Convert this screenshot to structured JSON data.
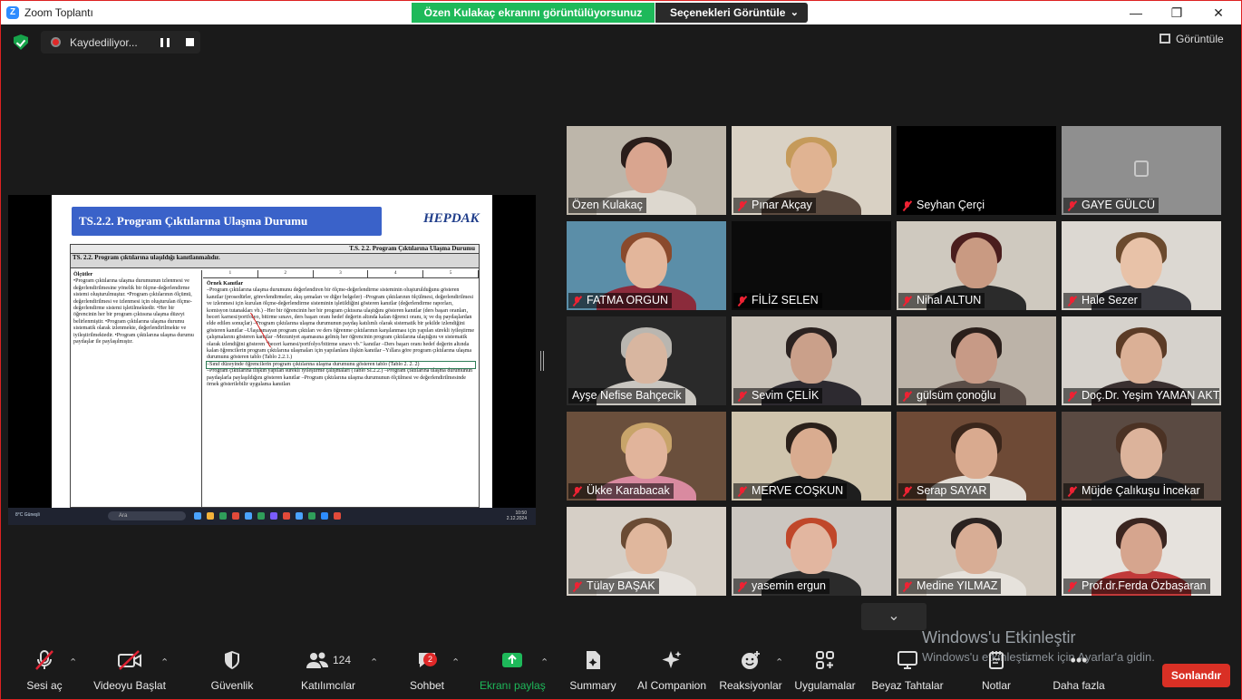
{
  "window": {
    "title": "Zoom Toplantı"
  },
  "share_banner": {
    "text": "Özen Kulakaç ekranını görüntülüyorsunuz",
    "options_label": "Seçenekleri Görüntüle"
  },
  "recording": {
    "label": "Kaydediliyor..."
  },
  "view_button": {
    "label": "Görüntüle"
  },
  "shared_doc": {
    "header": "TS.2.2. Program Çıktılarına Ulaşma Durumu",
    "logo": "HEPDAK",
    "table_title": "T.S. 2.2. Program Çıktılarına Ulaşma Durumu",
    "table_subtitle": "TS. 2.2. Program çıktılarına ulaşıldığı kanıtlanmalıdır.",
    "left_heading": "Ölçütler",
    "left_text": "•Program çıktılarına ulaşma durumunun izlenmesi ve değerlendirilmesine yönelik bir ölçme-değerlendirme sistemi oluşturulmuştur. •Program çıktılarının ölçümü, değerlendirilmesi ve izlenmesi için oluşturulan ölçme-değerlendirme sistemi işletilmektedir. •Her bir öğrencinin her bir program çıktısına ulaşma düzeyi belirlenmiştir. •Program çıktılarına ulaşma durumu sistematik olarak izlenmekte, değerlendirilmekte ve iyileştirilmektedir. •Program çıktılarına ulaşma durumu paydaşlar ile paylaşılmıştır.",
    "right_heading": "Örnek Kanıtlar",
    "right_text": "–Program çıktılarına ulaşma durumunu değerlendiren bir ölçme-değerlendirme sisteminin oluşturulduğunu gösteren kanıtlar (prosedürler, görevlendirmeler, akış şemaları ve diğer belgeler) –Program çıktılarının ölçülmesi, değerlendirilmesi ve izlenmesi için kurulan ölçme-değerlendirme sisteminin işletildiğini gösteren kanıtlar (değerlendirme raporları, komisyon tutanakları vb.) –Her bir öğrencinin her bir program çıktısına ulaştığını gösteren kanıtlar (ders başarı oranları, beceri karnesi/portfolyo, bitirme sınavı, ders başarı oranı hedef değerin altında kalan öğrenci oranı, iç ve dış paydaşlardan elde edilen sonuçlar) –Program çıktılarına ulaşma durumunun paydaş katılımlı olarak sistematik bir şekilde izlendiğini gösteren kanıtlar –Ulaşılamayan program çıktıları ve ders öğrenme çıktılarının karşılanması için yapılan sürekli iyileştirme çalışmalarını gösteren kanıtlar –Mezuniyet aşamasına gelmiş her öğrencinin program çıktılarına ulaştığını ve sistematik olarak izlendiğini gösteren \"beceri karnesi/portfolyo/bitirme sınavı vb.\" kanıtlar –Ders başarı oranı hedef değerin altında kalan öğrencilerin program çıktılarına ulaşmaları için yapılanlara ilişkin kanıtlar –Yıllara göre program çıktılarına ulaşma durumunu gösteren tablo (Tablo 2.2.1.)",
    "highlight_text": "–Sınıf düzeyinde öğrencilerin program çıktılarına ulaşma durumunu gösteren tablo (Tablo 2. 2. 2)",
    "right_text_2": "–Program çıktılarına ilişkin yapılan sürekli iyileştirme çalışmaları (Tablo Sİ.2.2.) –Program çıktılarına ulaşma durumunun paydaşlarla paylaşıldığını gösteren kanıtlar –Program çıktılarına ulaşma durumunun ölçülmesi ve değerlendirilmesinde örnek gösterilebilir uygulama kanıtları",
    "col_numbers": [
      "1",
      "2",
      "3",
      "4",
      "5"
    ],
    "taskbar": {
      "weather": "8°C Güneşli",
      "search": "Ara",
      "time": "10:50",
      "date": "2.12.2024"
    }
  },
  "participants": [
    {
      "name": "Özen Kulakaç",
      "muted": false,
      "active": true,
      "bg": "#bdb6aa",
      "skin": "#d9a58f",
      "hair": "#2a1d1a",
      "shirt": "#ddd8cf"
    },
    {
      "name": "Pınar Akçay",
      "muted": true,
      "bg": "#d9d1c4",
      "skin": "#e0b392",
      "hair": "#c59a5a",
      "shirt": "#5b4a3f"
    },
    {
      "name": "Seyhan Çerçi",
      "muted": true,
      "bg": "#000000",
      "skin": "",
      "hair": "",
      "shirt": ""
    },
    {
      "name": "GAYE GÜLCÜ",
      "muted": true,
      "bg": "#8f8f8f",
      "skin": "",
      "hair": "",
      "shirt": "",
      "placeholder": true
    },
    {
      "name": "FATMA ORGUN",
      "muted": true,
      "bg": "#5b8ea8",
      "skin": "#e3b69b",
      "hair": "#8a4a2c",
      "shirt": "#8b2b3b"
    },
    {
      "name": "FİLİZ SELEN",
      "muted": true,
      "bg": "#0b0b0b",
      "skin": "",
      "hair": "",
      "shirt": ""
    },
    {
      "name": "Nihal ALTUN",
      "muted": true,
      "bg": "#cfc9bf",
      "skin": "#c99a82",
      "hair": "#4a1d1d",
      "shirt": "#2b2b2b"
    },
    {
      "name": "Hale Sezer",
      "muted": true,
      "bg": "#dcd8d2",
      "skin": "#e8c2a8",
      "hair": "#6b4a2e",
      "shirt": "#3a3a40"
    },
    {
      "name": "Ayşe Nefise Bahçecik",
      "muted": false,
      "bg": "#2a2a2a",
      "skin": "#d8b6a0",
      "hair": "#b9b6b0",
      "shirt": "#c9c6c0"
    },
    {
      "name": "Sevim ÇELİK",
      "muted": true,
      "bg": "#c9c2b8",
      "skin": "#caa08a",
      "hair": "#2b2220",
      "shirt": "#2d2a30"
    },
    {
      "name": "gülsüm çonoğlu",
      "muted": true,
      "bg": "#bcb3a8",
      "skin": "#c79a86",
      "hair": "#2a1f1b",
      "shirt": "#5a4d47"
    },
    {
      "name": "Doç.Dr. Yeşim YAMAN AKTAŞ",
      "muted": true,
      "bg": "#d6d2cc",
      "skin": "#dbb096",
      "hair": "#5b3b26",
      "shirt": "#3a3030"
    },
    {
      "name": "Ükke Karabacak",
      "muted": true,
      "bg": "#6a4f3c",
      "skin": "#e1b49b",
      "hair": "#c8a46a",
      "shirt": "#d98aa0"
    },
    {
      "name": "MERVE COŞKUN",
      "muted": true,
      "bg": "#cfc4ad",
      "skin": "#d9ac90",
      "hair": "#2a201a",
      "shirt": "#1e1e1e"
    },
    {
      "name": "Serap SAYAR",
      "muted": true,
      "bg": "#6e4a36",
      "skin": "#d9aa8f",
      "hair": "#3a261b",
      "shirt": "#e2ddd6"
    },
    {
      "name": "Müjde Çalıkuşu İncekar",
      "muted": true,
      "bg": "#5a4a42",
      "skin": "#dcb39b",
      "hair": "#4b3224",
      "shirt": "#2b2b2e"
    },
    {
      "name": "Tülay BAŞAK",
      "muted": true,
      "bg": "#d6cfc6",
      "skin": "#e0b79d",
      "hair": "#6a4b34",
      "shirt": "#e6e2dd"
    },
    {
      "name": "yasemin ergun",
      "muted": true,
      "bg": "#cbc6c0",
      "skin": "#e2b6a0",
      "hair": "#c0472a",
      "shirt": "#2b2b2b"
    },
    {
      "name": "Medine YILMAZ",
      "muted": true,
      "bg": "#d0c8bd",
      "skin": "#d8ad95",
      "hair": "#2a2220",
      "shirt": "#e6e2dc"
    },
    {
      "name": "Prof.dr.Ferda Özbaşaran",
      "muted": true,
      "bg": "#e6e2dd",
      "skin": "#d6a58e",
      "hair": "#3a2520",
      "shirt": "#c13a3a"
    }
  ],
  "watermark": {
    "line1": "Windows'u Etkinleştir",
    "line2": "Windows'u etkinleştirmek için Ayarlar'a gidin."
  },
  "toolbar": {
    "audio": "Sesi aç",
    "video": "Videoyu Başlat",
    "security": "Güvenlik",
    "participants": "Katılımcılar",
    "participants_count": "124",
    "chat": "Sohbet",
    "chat_badge": "2",
    "share": "Ekranı paylaş",
    "summary": "Summary",
    "companion": "AI Companion",
    "reactions": "Reaksiyonlar",
    "apps": "Uygulamalar",
    "whiteboards": "Beyaz Tahtalar",
    "notes": "Notlar",
    "more": "Daha fazla",
    "end": "Sonlandır"
  },
  "colors": {
    "share_green": "#1eb95a",
    "end_red": "#d93025",
    "active_border": "#c8e04a",
    "mute_red": "#e02233"
  }
}
